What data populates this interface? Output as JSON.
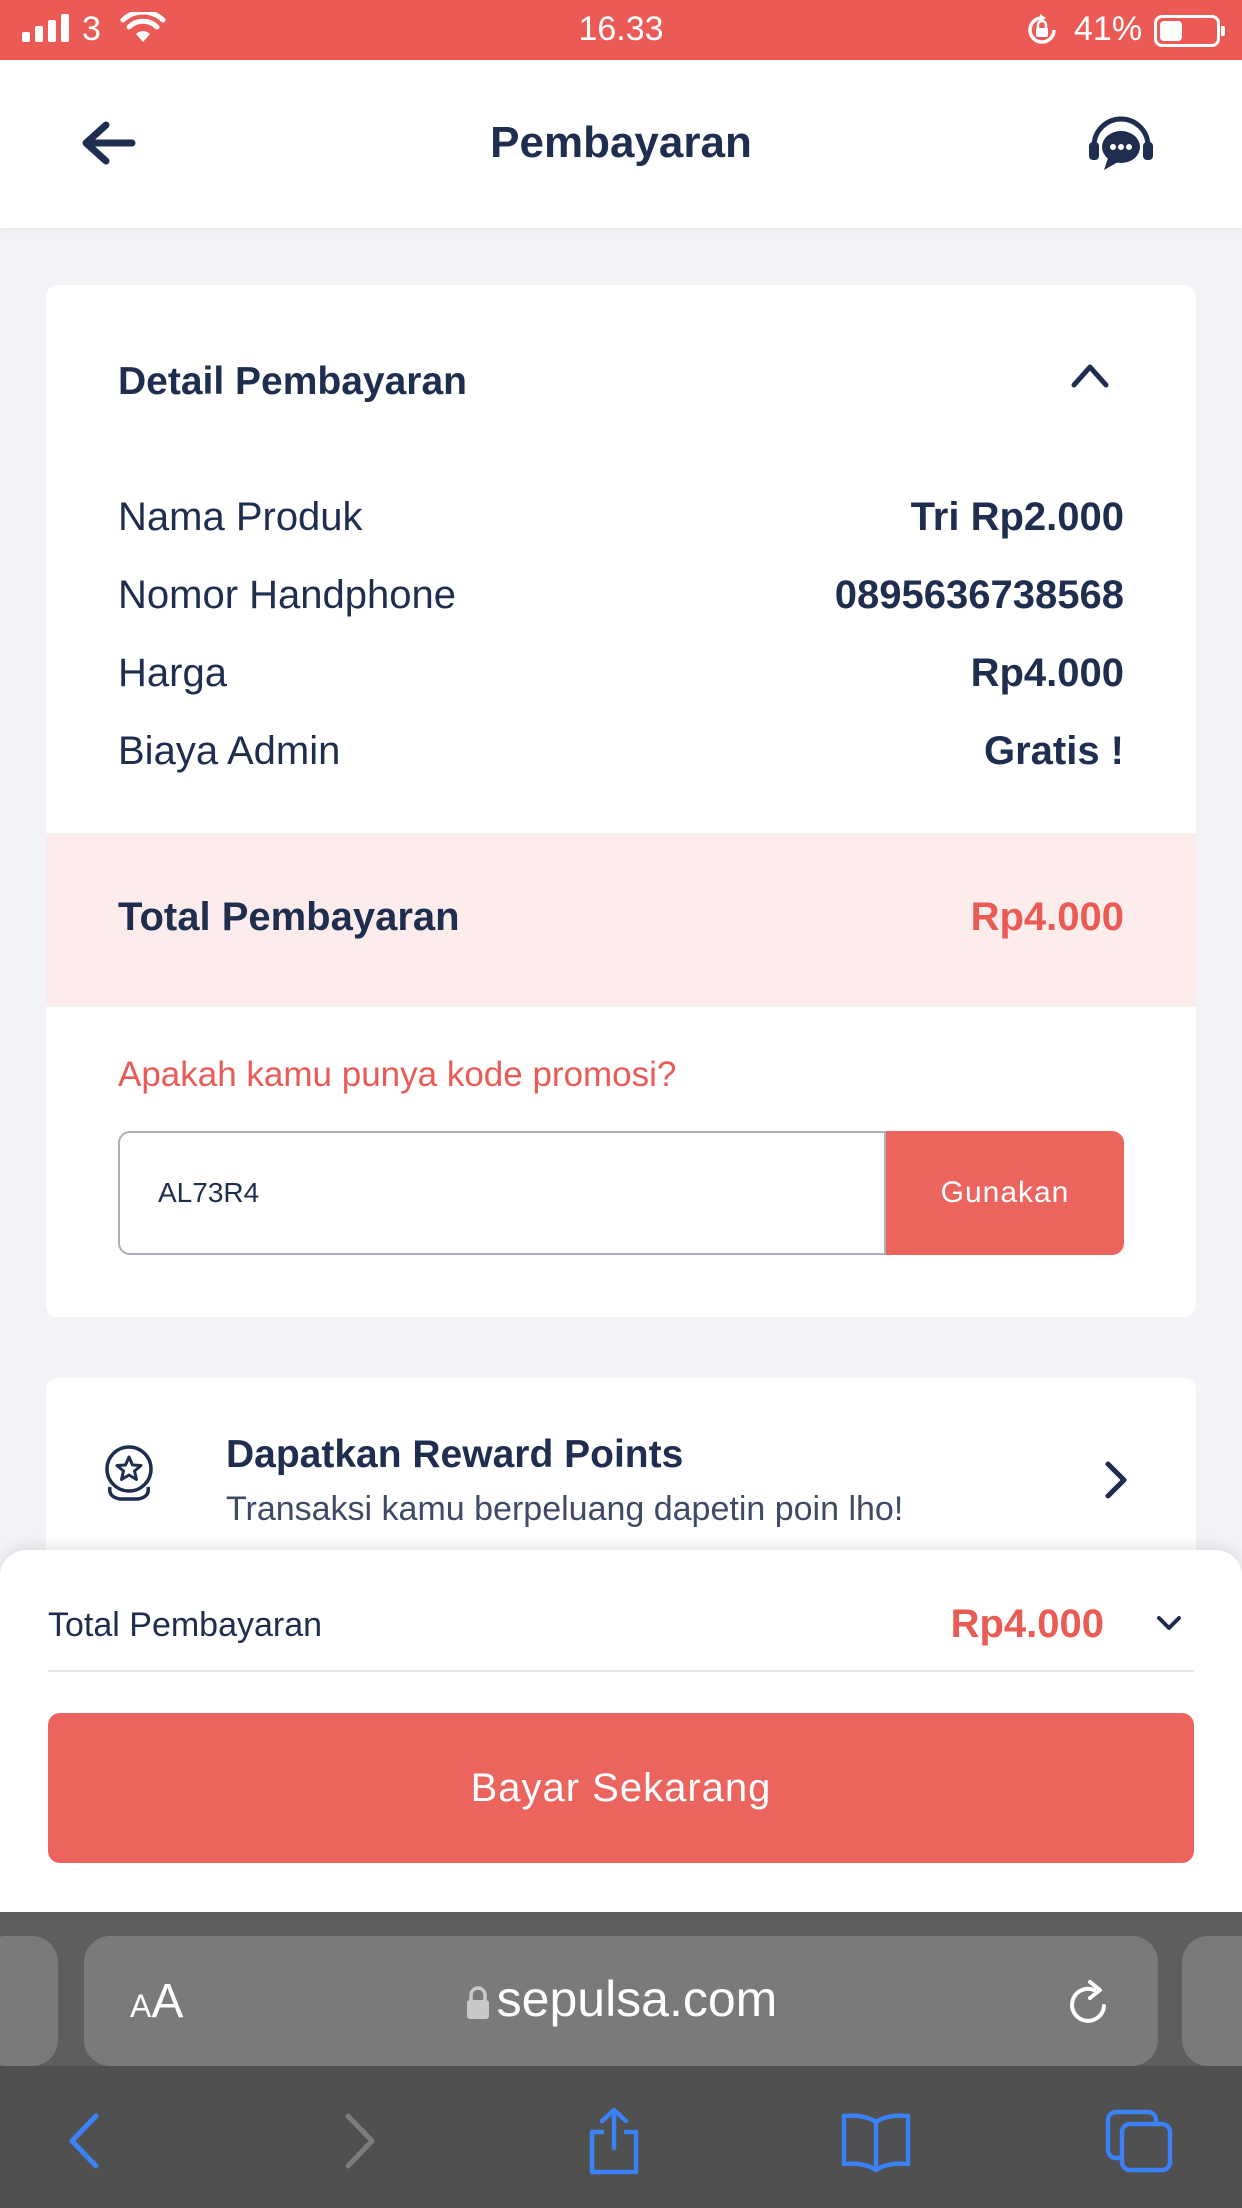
{
  "status_bar": {
    "carrier": "3",
    "time": "16.33",
    "battery": "41%"
  },
  "header": {
    "title": "Pembayaran",
    "back_icon": "arrow-left-icon",
    "help_icon": "chat-support-icon"
  },
  "payment_detail": {
    "heading": "Detail Pembayaran",
    "collapse_icon": "chevron-up-icon",
    "rows": [
      {
        "label": "Nama Produk",
        "value": "Tri Rp2.000"
      },
      {
        "label": "Nomor Handphone",
        "value": "0895636738568"
      },
      {
        "label": "Harga",
        "value": "Rp4.000"
      },
      {
        "label": "Biaya Admin",
        "value": "Gratis !"
      }
    ],
    "total_label": "Total Pembayaran",
    "total_value": "Rp4.000"
  },
  "promo": {
    "question": "Apakah kamu punya kode promosi?",
    "code_value": "AL73R4",
    "button_label": "Gunakan"
  },
  "reward": {
    "icon": "reward-medal-icon",
    "title": "Dapatkan Reward Points",
    "subtitle": "Transaksi kamu berpeluang dapetin poin lho!",
    "chevron_icon": "chevron-right-icon"
  },
  "bottom_sheet": {
    "total_label": "Total Pembayaran",
    "total_value": "Rp4.000",
    "expand_icon": "chevron-down-icon",
    "pay_button": "Bayar Sekarang"
  },
  "browser": {
    "text_size_label": "AA",
    "url": "sepulsa.com",
    "toolbar_icons": [
      "back-icon",
      "forward-icon",
      "share-icon",
      "bookmarks-icon",
      "tabs-icon"
    ]
  },
  "colors": {
    "status_bar": "#ec5a55",
    "accent": "#ec645e",
    "navy_text": "#1f2d4f",
    "total_band": "#fcecec",
    "safari_blue": "#3b82f6"
  }
}
